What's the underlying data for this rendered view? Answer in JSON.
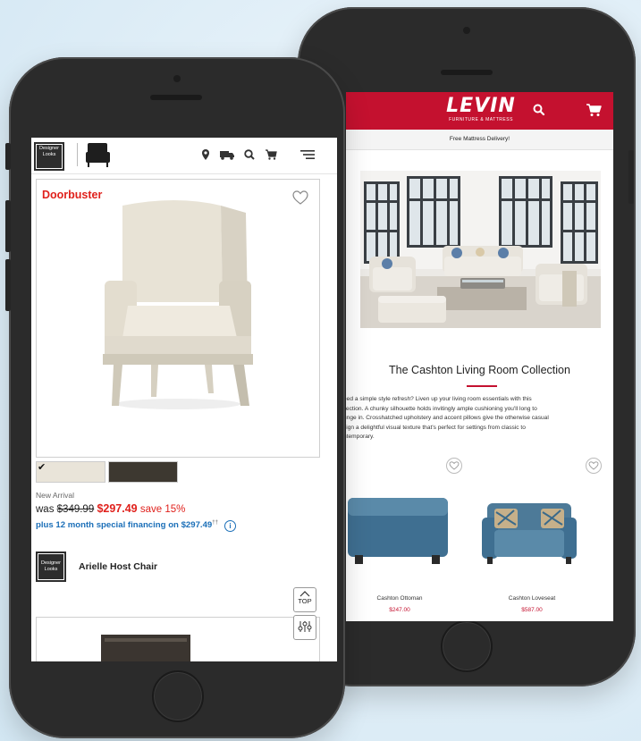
{
  "right_phone": {
    "header": {
      "logo_main": "LEVIN",
      "logo_sub": "FURNITURE & MATTRESS",
      "search_icon": "search-icon",
      "cart_icon": "cart-icon",
      "brand_color": "#c4112f"
    },
    "promo": "Free Mattress Delivery!",
    "collection": {
      "title": "The Cashton Living Room Collection",
      "description_lines": [
        "eed a simple style refresh? Liven up your living room essentials with this",
        "llection. A chunky silhouette holds invitingly ample cushioning you'll long to",
        "unge in. Crosshatched upholstery and accent pillows give the otherwise casual",
        "sign a delightful visual texture that's perfect for settings from classic to",
        "ntemporary."
      ]
    },
    "products": [
      {
        "name": "Cashton Ottoman",
        "price": "$247.00"
      },
      {
        "name": "Cashton Loveseat",
        "price": "$587.00"
      }
    ]
  },
  "left_phone": {
    "header": {
      "brand_logo_line1": "Designer",
      "brand_logo_line2": "Looks",
      "icons": [
        "location-icon",
        "delivery-truck-icon",
        "search-icon",
        "cart-icon",
        "menu-icon"
      ]
    },
    "product": {
      "badge": "Doorbuster",
      "label": "New Arrival",
      "was_label": "was",
      "old_price": "$349.99",
      "price": "$297.49",
      "save": "save 15%",
      "financing": "plus 12 month special financing on $297.49",
      "financing_sup": "††",
      "info_icon": "i",
      "brand_logo_line1": "Designer",
      "brand_logo_line2": "Looks",
      "name": "Arielle Host Chair",
      "swatches": [
        {
          "color": "#e9e4d9",
          "selected": true
        },
        {
          "color": "#3d3830",
          "selected": false
        }
      ]
    },
    "top_button": "TOP",
    "accent_red": "#e0211c",
    "accent_blue": "#1b6fb8"
  }
}
